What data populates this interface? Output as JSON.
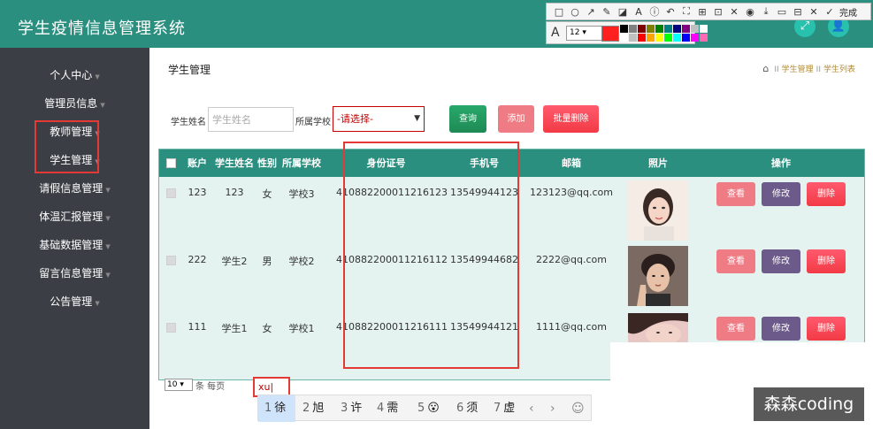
{
  "app": {
    "title": "学生疫情信息管理系统"
  },
  "header_icons": [
    {
      "name": "fullscreen-icon",
      "glyph": "⤢"
    },
    {
      "name": "user-icon",
      "glyph": "👤"
    }
  ],
  "snip_tool": {
    "tools": [
      "□",
      "○",
      "↗",
      "✎",
      "◪",
      "A",
      "ⓘ",
      "↶",
      "⛶",
      "⊞",
      "⊡",
      "✕",
      "◉",
      "⤓",
      "▭",
      "⊟",
      "✕",
      "✓"
    ],
    "done_label": "完成",
    "font_size": "12",
    "current_color": "#ff2020",
    "palette": [
      "#000000",
      "#808080",
      "#800000",
      "#808000",
      "#008000",
      "#008080",
      "#000080",
      "#800080",
      "#c0c0c0",
      "#ffffff",
      "#ffffff",
      "#c0c0c0",
      "#ff0000",
      "#ffa500",
      "#ffff00",
      "#00ff00",
      "#00ffff",
      "#0000ff",
      "#ff00ff",
      "#ff69b4"
    ]
  },
  "sidebar": {
    "items": [
      {
        "label": "个人中心"
      },
      {
        "label": "管理员信息"
      },
      {
        "label": "教师管理"
      },
      {
        "label": "学生管理"
      },
      {
        "label": "请假信息管理"
      },
      {
        "label": "体温汇报管理"
      },
      {
        "label": "基础数据管理"
      },
      {
        "label": "留言信息管理"
      },
      {
        "label": "公告管理"
      }
    ]
  },
  "breadcrumb": {
    "title": "学生管理",
    "items": [
      "学生管理",
      "学生列表"
    ]
  },
  "search": {
    "name_label": "学生姓名",
    "name_placeholder": "学生姓名",
    "school_label": "所属学校",
    "school_selected": "-请选择-"
  },
  "buttons": {
    "query": "查询",
    "add": "添加",
    "batch_delete": "批量删除"
  },
  "table": {
    "headers": [
      "账户",
      "学生姓名",
      "性别",
      "所属学校",
      "身份证号",
      "手机号",
      "邮箱",
      "照片",
      "操作"
    ],
    "rows": [
      {
        "account": "123",
        "name": "123",
        "gender": "女",
        "school": "学校3",
        "id_card": "410882200011216123",
        "phone": "13549944123",
        "email": "123123@qq.com"
      },
      {
        "account": "222",
        "name": "学生2",
        "gender": "男",
        "school": "学校2",
        "id_card": "410882200011216112",
        "phone": "13549944682",
        "email": "2222@qq.com"
      },
      {
        "account": "111",
        "name": "学生1",
        "gender": "女",
        "school": "学校1",
        "id_card": "410882200011216111",
        "phone": "13549944121",
        "email": "1111@qq.com"
      }
    ],
    "actions": {
      "view": "查看",
      "edit": "修改",
      "delete": "删除"
    }
  },
  "pagination": {
    "page_size": "10",
    "page_size_label": "条 每页"
  },
  "ime": {
    "input": "xu",
    "candidates": [
      {
        "num": "1",
        "text": "徐"
      },
      {
        "num": "2",
        "text": "旭"
      },
      {
        "num": "3",
        "text": "许"
      },
      {
        "num": "4",
        "text": "需"
      },
      {
        "num": "5",
        "text": "😮"
      },
      {
        "num": "6",
        "text": "须"
      },
      {
        "num": "7",
        "text": "虚"
      }
    ],
    "prev": "‹",
    "next": "›",
    "emoji": "☺"
  },
  "watermark": "森森coding"
}
